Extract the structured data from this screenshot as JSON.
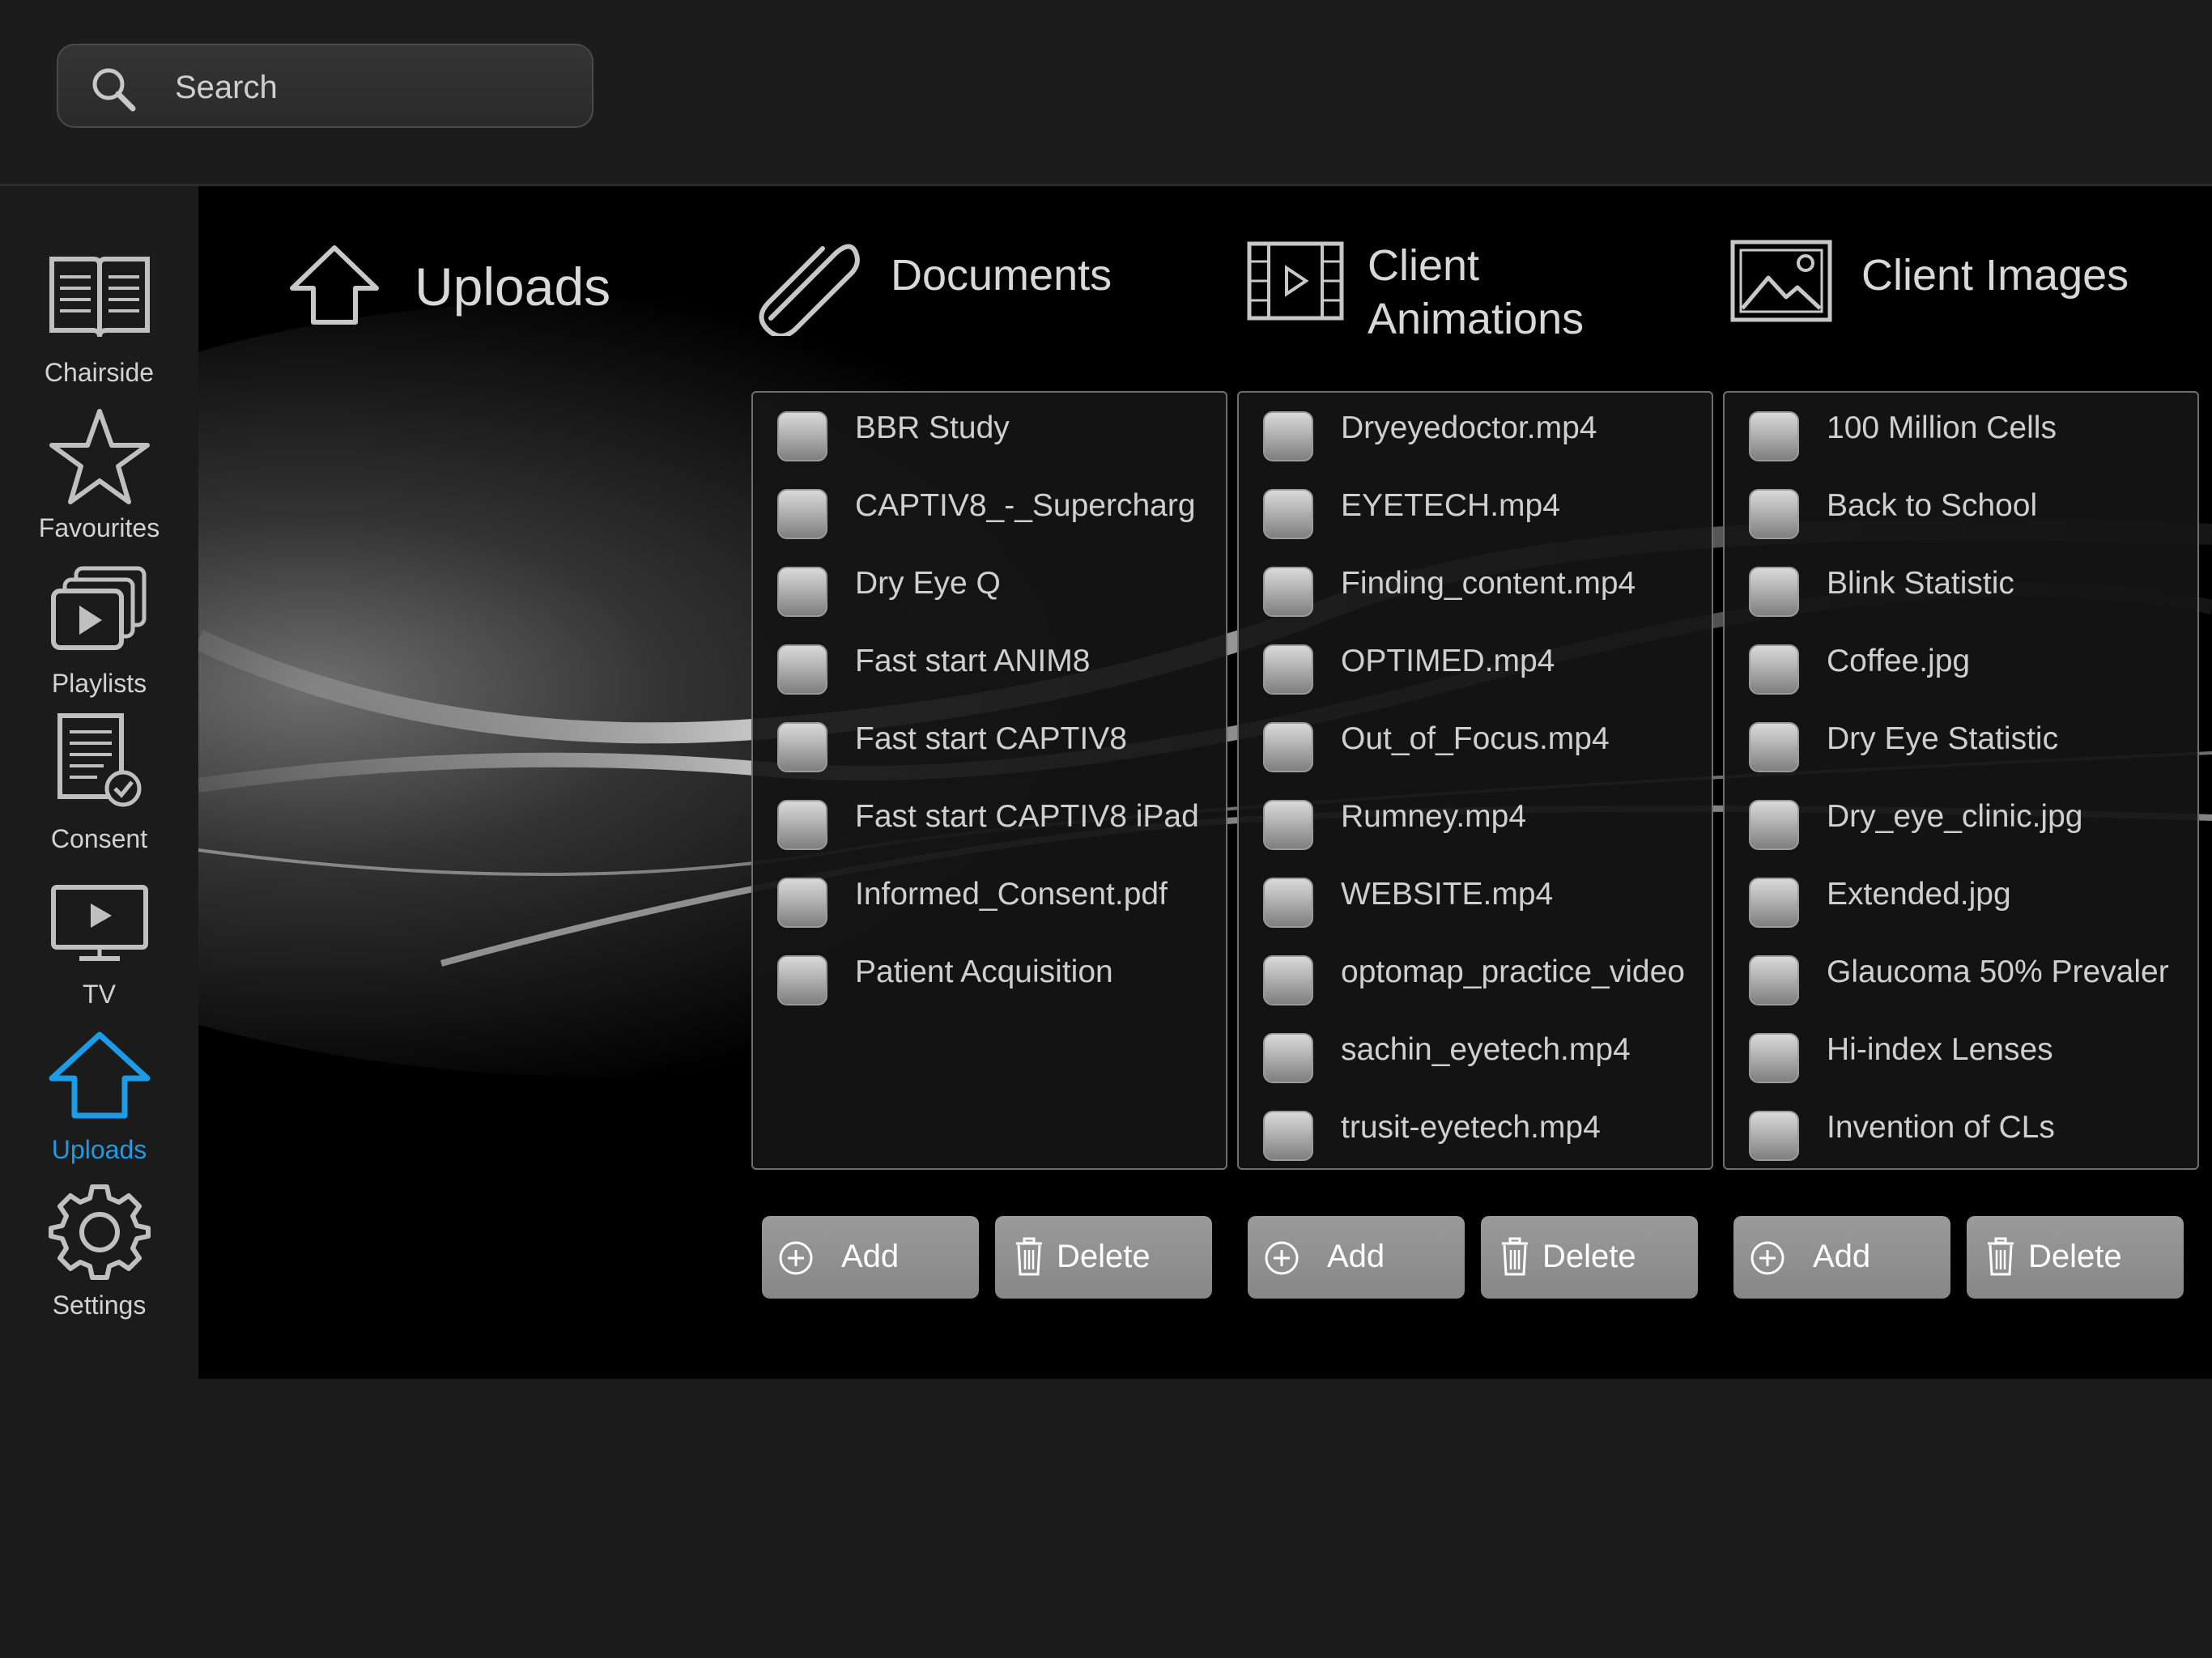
{
  "search": {
    "placeholder": "Search"
  },
  "sidebar": {
    "items": [
      {
        "label": "Chairside",
        "icon": "book-icon"
      },
      {
        "label": "Favourites",
        "icon": "star-icon"
      },
      {
        "label": "Playlists",
        "icon": "playlist-icon"
      },
      {
        "label": "Consent",
        "icon": "consent-document-icon"
      },
      {
        "label": "TV",
        "icon": "tv-icon"
      },
      {
        "label": "Uploads",
        "icon": "upload-arrow-icon",
        "active": true
      },
      {
        "label": "Settings",
        "icon": "gear-icon"
      }
    ],
    "active_color": "#1b9be8"
  },
  "main": {
    "title": "Uploads",
    "sections": [
      {
        "heading": "Documents",
        "icon": "paperclip-icon",
        "items": [
          "BBR Study",
          "CAPTIV8_-_Supercharg",
          "Dry Eye Q",
          "Fast start ANIM8",
          "Fast start CAPTIV8",
          "Fast start CAPTIV8 iPad",
          "Informed_Consent.pdf",
          "Patient Acquisition"
        ],
        "add_label": "Add",
        "delete_label": "Delete"
      },
      {
        "heading_line1": "Client",
        "heading_line2": "Animations",
        "icon": "film-icon",
        "items": [
          "Dryeyedoctor.mp4",
          "EYETECH.mp4",
          "Finding_content.mp4",
          "OPTIMED.mp4",
          "Out_of_Focus.mp4",
          "Rumney.mp4",
          "WEBSITE.mp4",
          "optomap_practice_video",
          "sachin_eyetech.mp4",
          "trusit-eyetech.mp4"
        ],
        "add_label": "Add",
        "delete_label": "Delete"
      },
      {
        "heading": "Client Images",
        "icon": "image-icon",
        "items": [
          "100 Million Cells",
          "Back to School",
          "Blink Statistic",
          "Coffee.jpg",
          "Dry Eye Statistic",
          "Dry_eye_clinic.jpg",
          "Extended.jpg",
          "Glaucoma 50% Prevaler",
          "Hi-index Lenses",
          "Invention of CLs"
        ],
        "add_label": "Add",
        "delete_label": "Delete"
      }
    ]
  }
}
